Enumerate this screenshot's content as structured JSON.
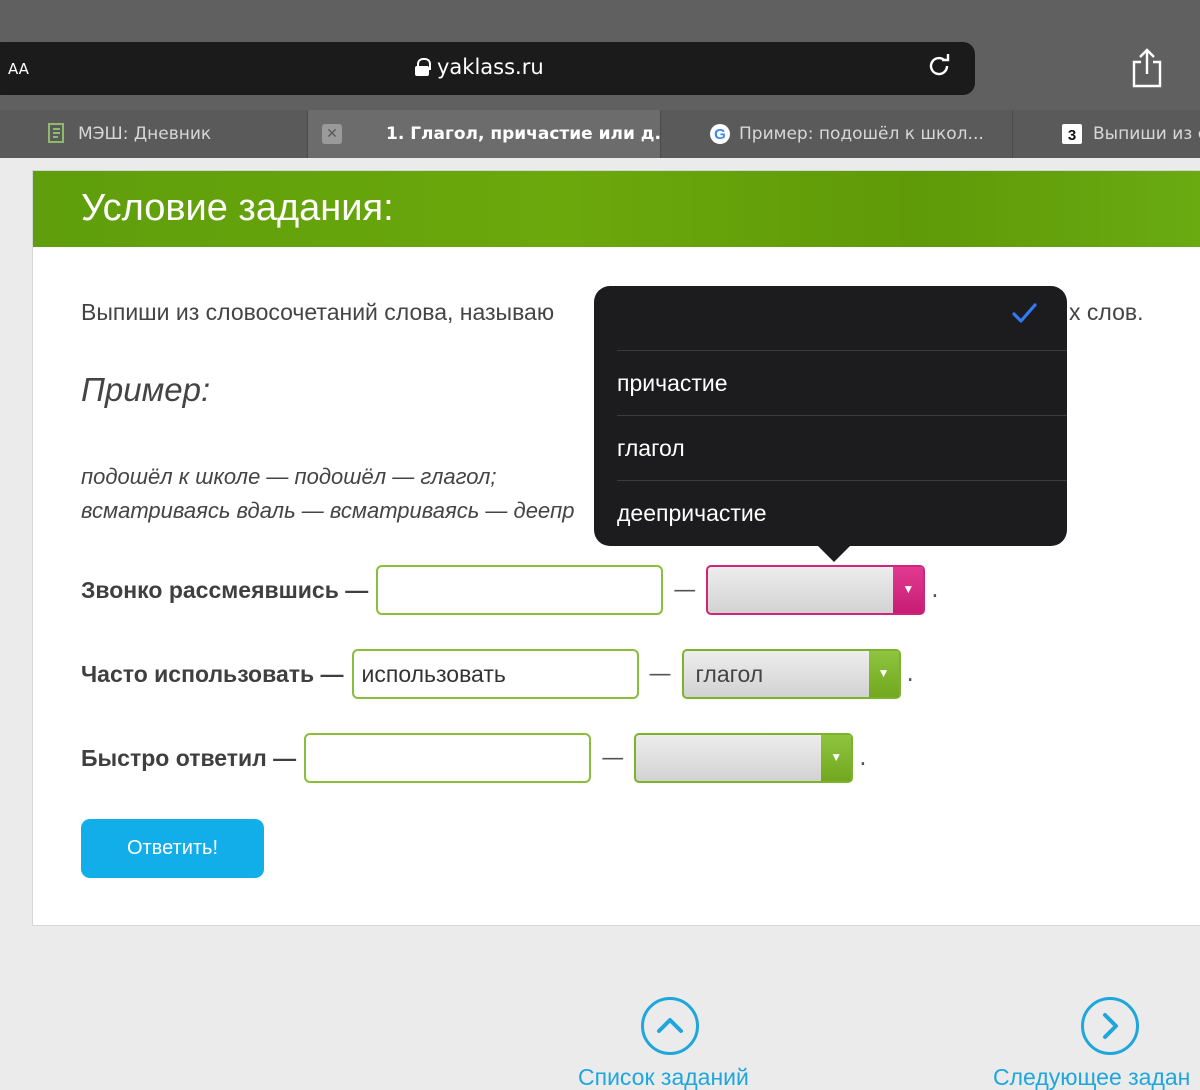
{
  "browser": {
    "text_size_label": "AA",
    "url": "yaklass.ru",
    "tabs": [
      {
        "title": "МЭШ: Дневник"
      },
      {
        "title": "1. Глагол, причастие или д..."
      },
      {
        "title": "Пример: подошёл к школ..."
      },
      {
        "title": "Выпиши из сл"
      }
    ]
  },
  "task": {
    "header": "Условие задания:",
    "instruction_start": "Выпиши из словосочетаний слова, называю",
    "instruction_end": "х слов.",
    "example_title": "Пример:",
    "example_line1": "подошёл к школе — подошёл — глагол;",
    "example_line2": "всматриваясь вдаль — всматриваясь — деепр",
    "rows": [
      {
        "label": "Звонко рассмеявшись —",
        "answer": "",
        "select_value": ""
      },
      {
        "label": "Часто использовать —",
        "answer": "использовать",
        "select_value": "глагол"
      },
      {
        "label": "Быстро ответил —",
        "answer": "",
        "select_value": ""
      }
    ],
    "dash": "—",
    "period": ".",
    "submit_label": "Ответить!"
  },
  "dropdown": {
    "options": [
      "",
      "причастие",
      "глагол",
      "деепричастие"
    ],
    "selected_index": 0,
    "check_color": "#2f7bf5"
  },
  "nav": {
    "list_label": "Список заданий",
    "next_label": "Следующее задан"
  },
  "colors": {
    "accent_green": "#6ba80c",
    "accent_blue": "#12aeea",
    "open_select": "#d0247d"
  }
}
